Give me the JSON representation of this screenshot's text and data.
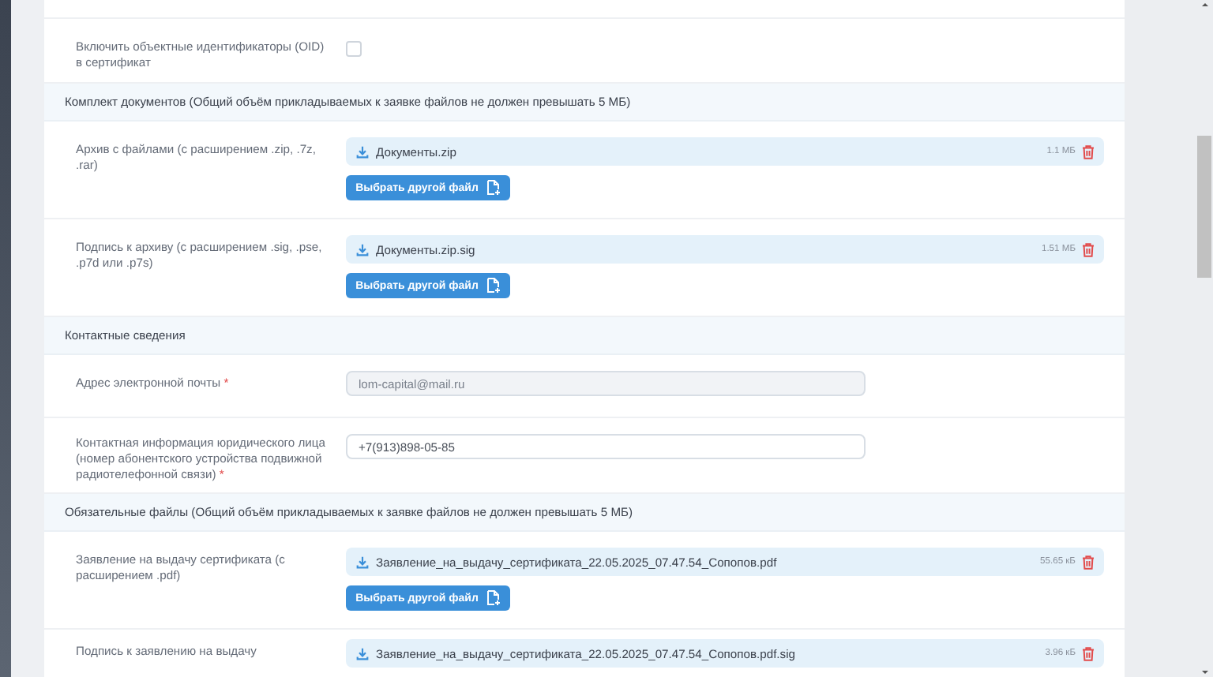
{
  "form": [
    {
      "kind": "checkbox",
      "label": "Включить объектные идентификаторы (OID) в сертификат",
      "checked": false
    },
    {
      "kind": "section",
      "title": "Комплект документов (Общий объём прикладываемых к заявке файлов не должен превышать 5 МБ)"
    },
    {
      "kind": "file",
      "label": "Архив с файлами (с расширением .zip, .7z, .rar)",
      "file_name": "Документы.zip",
      "size": "1.1 МБ",
      "button": "Выбрать другой файл"
    },
    {
      "kind": "file",
      "label": "Подпись к архиву (с расширением .sig, .pse, .p7d или .p7s)",
      "file_name": "Документы.zip.sig",
      "size": "1.51 МБ",
      "button": "Выбрать другой файл"
    },
    {
      "kind": "section",
      "title": "Контактные сведения"
    },
    {
      "kind": "input",
      "label": "Адрес электронной почты",
      "required_mark": "*",
      "value": "lom-capital@mail.ru",
      "disabled": true
    },
    {
      "kind": "input",
      "label": "Контактная информация юридического лица (номер абонентского устройства подвижной радиотелефонной связи)",
      "required_mark": "*",
      "value": "+7(913)898-05-85",
      "disabled": false
    },
    {
      "kind": "section",
      "title": "Обязательные файлы (Общий объём прикладываемых к заявке файлов не должен превышать 5 МБ)"
    },
    {
      "kind": "file",
      "label": "Заявление на выдачу сертификата (с расширением .pdf)",
      "file_name": "Заявление_на_выдачу_сертификата_22.05.2025_07.47.54_Сопопов.pdf",
      "size": "55.65 кБ",
      "button": "Выбрать другой файл"
    },
    {
      "kind": "file",
      "label": "Подпись к заявлению на выдачу",
      "file_name": "Заявление_на_выдачу_сертификата_22.05.2025_07.47.54_Сопопов.pdf.sig",
      "size": "3.96 кБ"
    }
  ]
}
